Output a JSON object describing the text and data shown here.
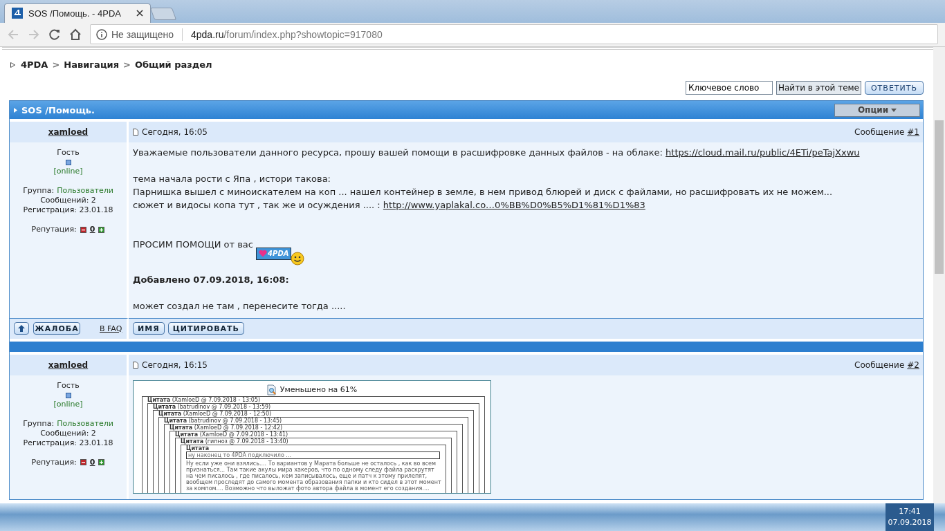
{
  "browser": {
    "tab": {
      "title": "SOS /Помощь. - 4PDA"
    },
    "security": "Не защищено",
    "url_host": "4pda.ru",
    "url_path": "/forum/index.php?showtopic=917080"
  },
  "breadcrumbs": {
    "separator": ">",
    "items": [
      "4PDA",
      "Навигация",
      "Общий раздел"
    ]
  },
  "topic_tools": {
    "search_value": "Ключевое слово",
    "search_button": "Найти в этой теме",
    "reply_button": "ОТВЕТИТЬ"
  },
  "topic": {
    "title": "SOS /Помощь.",
    "options_button": "Опции"
  },
  "posts": [
    {
      "author": "xamloed",
      "date": "Сегодня, 16:05",
      "message_label": "Сообщение",
      "number": "#1",
      "rank": "Гость",
      "status": "[online]",
      "group_label": "Группа:",
      "group": "Пользователи",
      "post_count": "Сообщений: 2",
      "registered": "Регистрация: 23.01.18",
      "reputation_label": "Репутация:",
      "reputation": "0",
      "body": [
        {
          "kind": "paragraph",
          "bold": false,
          "parts": [
            {
              "text": "Уважаемые пользователи данного ресурса, прошу вашей помощи в расшифровке данных файлов - на облаке: "
            },
            {
              "link": "https://cloud.mail.ru/public/4ETi/peTajXxwu"
            }
          ]
        },
        {
          "kind": "spacer"
        },
        {
          "kind": "paragraph",
          "bold": false,
          "parts": [
            {
              "text": "тема начала рости с Япа , истори такова:"
            }
          ]
        },
        {
          "kind": "paragraph",
          "bold": false,
          "parts": [
            {
              "text": "Парнишка вышел с миноискателем на коп ... нашел контейнер в земле, в нем привод блюрей и диск с файлами, но расшифровать их не можем..."
            }
          ]
        },
        {
          "kind": "paragraph",
          "bold": false,
          "parts": [
            {
              "text": "сюжет и видосы копа тут , так же и осуждения .... : "
            },
            {
              "link": "http://www.yaplakal.co…0%BB%D0%B5%D1%81%D1%83"
            }
          ]
        },
        {
          "kind": "spacer"
        },
        {
          "kind": "spacer"
        },
        {
          "kind": "paragraph",
          "bold": false,
          "parts": [
            {
              "text": "ПРОСИМ ПОМОЩИ от вас "
            },
            {
              "emoticon": "4PDA"
            }
          ]
        },
        {
          "kind": "spacer"
        },
        {
          "kind": "paragraph",
          "bold": true,
          "parts": [
            {
              "text": "Добавлено 07.09.2018, 16:08:"
            }
          ]
        },
        {
          "kind": "spacer"
        },
        {
          "kind": "paragraph",
          "bold": false,
          "parts": [
            {
              "text": "может создал не там , перенесите тогда ....."
            }
          ]
        }
      ],
      "footer": {
        "buttons": [
          "ЖАЛОБА"
        ],
        "faq_link": "В FAQ",
        "post_buttons": [
          "ИМЯ",
          "ЦИТИРОВАТЬ"
        ]
      }
    },
    {
      "author": "xamloed",
      "date": "Сегодня, 16:15",
      "message_label": "Сообщение",
      "number": "#2",
      "rank": "Гость",
      "status": "[online]",
      "group_label": "Группа:",
      "group": "Пользователи",
      "post_count": "Сообщений: 2",
      "registered": "Регистрация: 23.01.18",
      "reputation_label": "Репутация:",
      "reputation": "0",
      "body": [
        {
          "kind": "screenshot",
          "caption": "Уменьшено на 61%",
          "quotes": [
            {
              "header": "**Цитата** (XamloeD @ 7.09.2018 - 13:05)",
              "children": [
                {
                  "header": "**Цитата** (batrudinov @ 7.09.2018 - 13:59)",
                  "children": [
                    {
                      "header": "**Цитата** (XamloeD @ 7.09.2018 - 12:50)",
                      "children": [
                        {
                          "header": "**Цитата** (batrudinov @ 7.09.2018 - 13:45)",
                          "children": [
                            {
                              "header": "**Цитата** (XamloeD @ 7.09.2018 - 12:42)",
                              "children": [
                                {
                                  "header": "**Цитата** (XamloeD @ 7.09.2018 - 13:41)",
                                  "children": [
                                    {
                                      "header": "**Цитата** (гипноз @ 7.09.2018 - 13:40)",
                                      "children": [
                                        {
                                          "header": "**Цитата**",
                                          "quote": "ну наконец то 4PDA подключило ...",
                                          "text": "Ну если уже они взялись.... То вариантов у Марата больше не осталось , как во всем признаться... Там такие акулы мира хакеров, что по одному следу файла раскрутят на чем писалось , где писалось, кем записывалось, еще и патч к этому прилепят, вообщем проследят до самого момента образования папки и кто сидел в этот момент за компом.... Возможно что выложат фото автора файла в момент его создания...."
                                        }
                                      ]
                                    }
                                  ]
                                }
                              ]
                            }
                          ]
                        }
                      ]
                    }
                  ]
                }
              ]
            }
          ]
        }
      ]
    }
  ],
  "taskbar": {
    "time": "17:41",
    "date": "07.09.2018"
  }
}
